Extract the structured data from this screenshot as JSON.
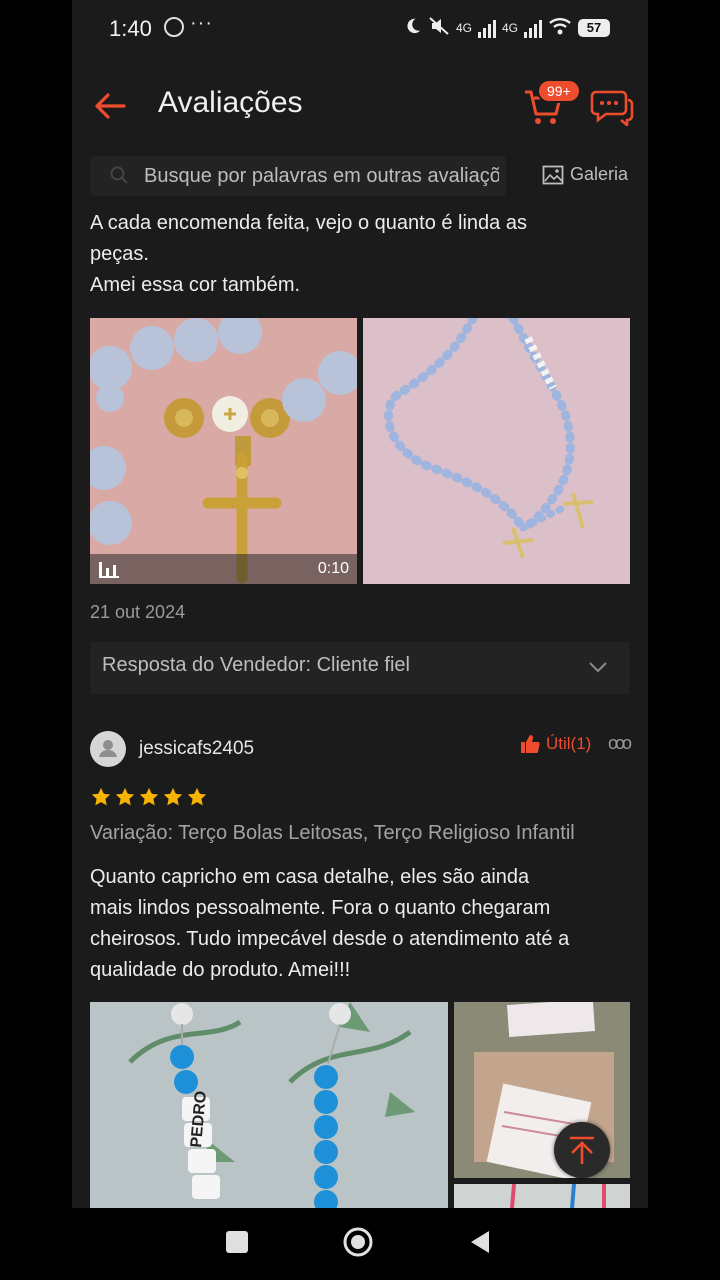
{
  "status_bar": {
    "time": "1:40",
    "dots": "···",
    "network1": "4G",
    "network2": "4G",
    "battery": "57"
  },
  "header": {
    "title": "Avaliações",
    "cart_badge": "99+"
  },
  "search": {
    "placeholder": "Busque por palavras em outras avaliações",
    "gallery_label": "Galeria"
  },
  "review1": {
    "text_lines": [
      "A cada encomenda feita, vejo o quanto é linda as",
      "peças.",
      "Amei essa cor também."
    ],
    "video_duration": "0:10",
    "date": "21 out 2024",
    "seller_reply": "Resposta do Vendedor: Cliente fiel"
  },
  "review2": {
    "username": "jessicafs2405",
    "useful": "Útil(1)",
    "rating": 5,
    "variation": "Variação: Terço Bolas Leitosas, Terço Religioso Infantil",
    "text_lines": [
      "Quanto capricho em casa detalhe, eles são ainda",
      "mais lindos pessoalmente. Fora o quanto chegaram",
      "cheirosos. Tudo impecável desde o atendimento até a",
      "qualidade do produto. Amei!!!"
    ],
    "photo_name": "PEDRO"
  },
  "colors": {
    "accent": "#ee4d2d",
    "star": "#f6b400",
    "background": "#1b1b1b"
  }
}
